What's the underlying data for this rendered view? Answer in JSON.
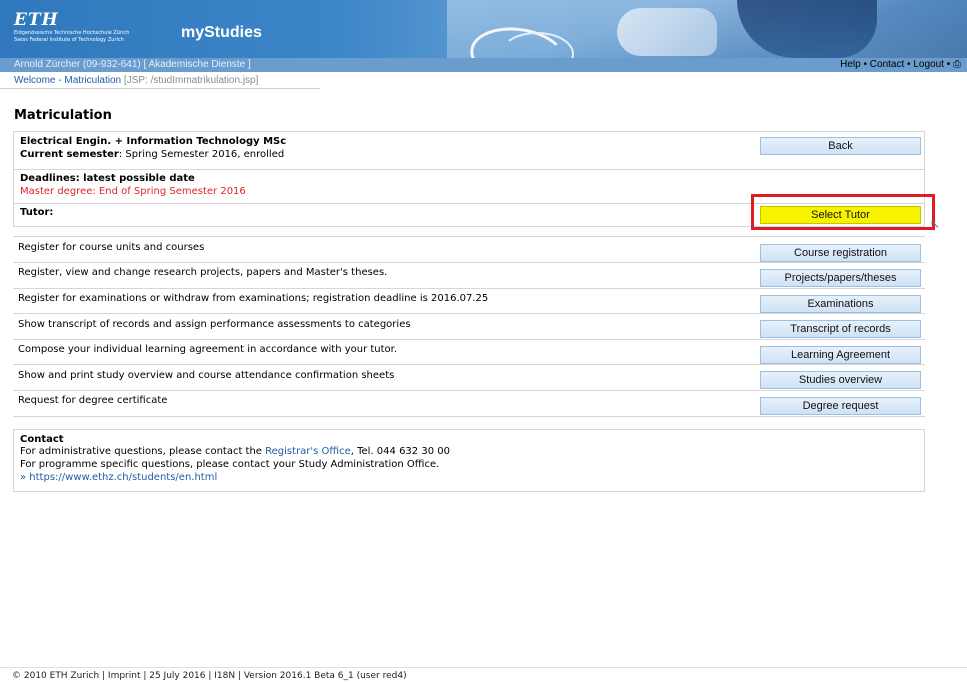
{
  "header": {
    "logo": "ETH",
    "logo_sub1": "Eidgenössische Technische Hochschule Zürich",
    "logo_sub2": "Swiss Federal Institute of Technology Zurich",
    "app_title": "myStudies"
  },
  "userbar": {
    "user": "Arnold Zürcher (09-932-641) [ Akademische Dienste ]",
    "help": "Help",
    "contact": "Contact",
    "logout": "Logout",
    "bullet": "•"
  },
  "breadcrumb": {
    "welcome": "Welcome",
    "separator": "-",
    "current": "Matriculation",
    "jsp": "[JSP: /studImmatrikulation.jsp]"
  },
  "page_title": "Matriculation",
  "program": {
    "name": "Electrical Engin. + Information Technology MSc",
    "semester_label": "Current semester",
    "semester_value": ": Spring Semester 2016, enrolled",
    "back_button": "Back"
  },
  "deadlines": {
    "title": "Deadlines: latest possible date",
    "master": "Master degree: End of Spring Semester 2016"
  },
  "tutor": {
    "label": "Tutor:",
    "button": "Select Tutor"
  },
  "actions": [
    {
      "text": "Register for course units and courses",
      "button": "Course registration"
    },
    {
      "text": "Register, view and change research projects, papers and Master's theses.",
      "button": "Projects/papers/theses"
    },
    {
      "text": "Register for examinations or withdraw from examinations; registration deadline is 2016.07.25",
      "button": "Examinations"
    },
    {
      "text": "Show transcript of records and assign performance assessments to categories",
      "button": "Transcript of records"
    },
    {
      "text": "Compose your individual learning agreement in accordance with your tutor.",
      "button": "Learning Agreement"
    },
    {
      "text": "Show and print study overview and course attendance confirmation sheets",
      "button": "Studies overview"
    },
    {
      "text": "Request for degree certificate",
      "button": "Degree request"
    }
  ],
  "contact": {
    "title": "Contact",
    "line1_pre": "For administrative questions, please contact the ",
    "line1_link": "Registrar's Office",
    "line1_post": ", Tel. 044 632 30 00",
    "line2": "For programme specific questions, please contact your Study Administration Office.",
    "url": "» https://www.ethz.ch/students/en.html"
  },
  "footer": "© 2010 ETH Zurich | Imprint | 25 July 2016 | I18N | Version 2016.1 Beta 6_1 (user red4)",
  "colors": {
    "banner_blue": "#3c86c8",
    "userbar_blue": "#6a9ccd",
    "link_blue": "#1f5da6",
    "deadline_red": "#e0242a",
    "highlight_red": "#e01b24",
    "select_tutor_yellow": "#f8f400"
  }
}
